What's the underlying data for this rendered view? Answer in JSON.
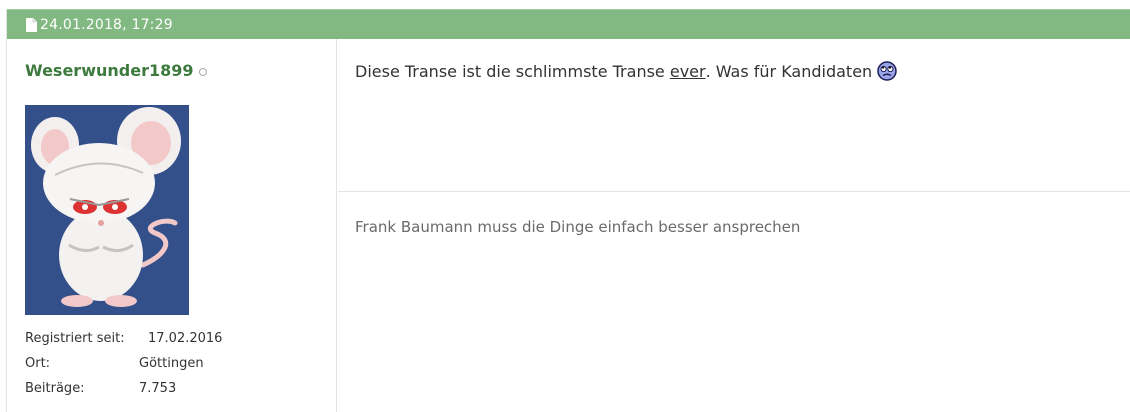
{
  "post": {
    "date": "24.01.2018, 17:29",
    "user": {
      "name": "Weserwunder1899",
      "online_status": "offline",
      "info": [
        {
          "label": "Registriert seit:",
          "value": "17.02.2016"
        },
        {
          "label": "Ort:",
          "value": "Göttingen"
        },
        {
          "label": "Beiträge:",
          "value": "7.753"
        }
      ]
    },
    "message": {
      "text_before": "Diese Transe ist die schlimmste Transe ",
      "emphasis": "ever",
      "text_after": ". Was für Kandidaten",
      "smiley": "rolleyes-smiley-icon"
    },
    "signature": "Frank Baumann muss die Dinge einfach besser ansprechen"
  },
  "colors": {
    "header_bg": "#82b882",
    "username": "#3d7a3d",
    "avatar_bg": "#34508b"
  }
}
